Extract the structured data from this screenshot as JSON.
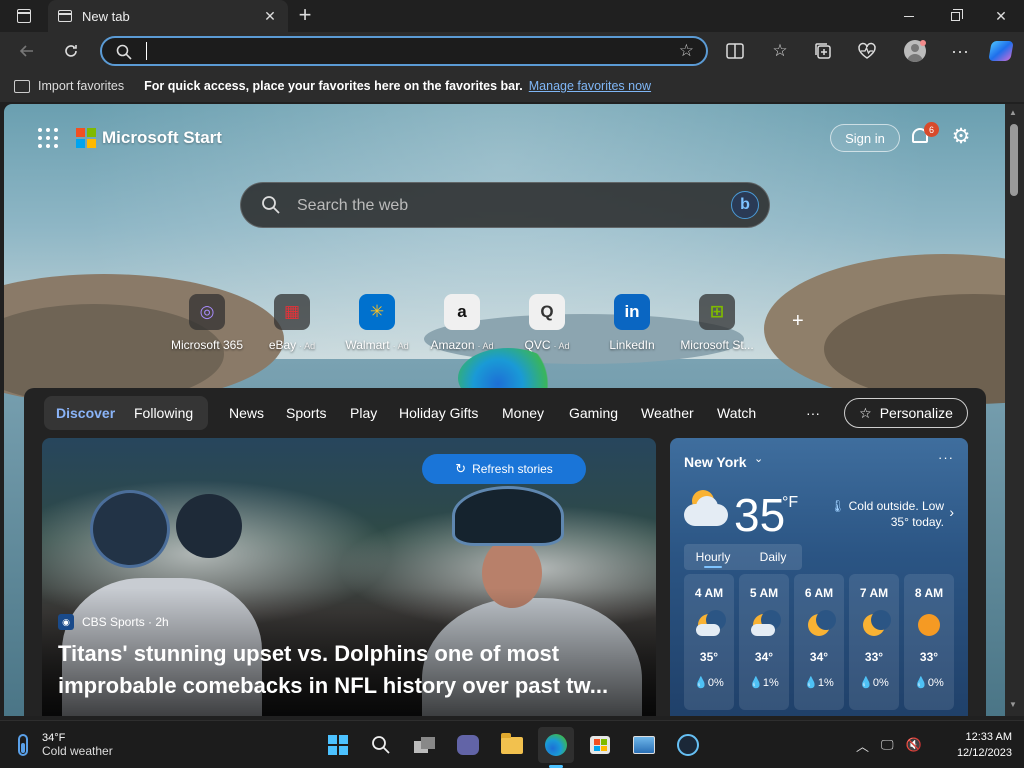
{
  "browser": {
    "tab_title": "New tab",
    "close_glyph": "✕",
    "new_tab_glyph": "+",
    "address_value": "",
    "favorites_bar": {
      "import_label": "Import favorites",
      "message": "For quick access, place your favorites here on the favorites bar.",
      "manage_link": "Manage favorites now"
    }
  },
  "start": {
    "brand": "Microsoft Start",
    "signin_label": "Sign in",
    "notification_count": "6",
    "search_placeholder": "Search the web",
    "quick_links": [
      {
        "label": "Microsoft 365",
        "ad": "",
        "glyph": "◎"
      },
      {
        "label": "eBay",
        "ad": "· Ad",
        "glyph": "▦"
      },
      {
        "label": "Walmart",
        "ad": "· Ad",
        "glyph": "✳"
      },
      {
        "label": "Amazon",
        "ad": "· Ad",
        "glyph": "a"
      },
      {
        "label": "QVC",
        "ad": "· Ad",
        "glyph": "Q"
      },
      {
        "label": "LinkedIn",
        "ad": "",
        "glyph": "in"
      },
      {
        "label": "Microsoft St...",
        "ad": "",
        "glyph": "⊞"
      }
    ],
    "add_link_glyph": "+"
  },
  "feed": {
    "tabs": [
      "Discover",
      "Following"
    ],
    "nav": [
      "News",
      "Sports",
      "Play",
      "Holiday Gifts",
      "Money",
      "Gaming",
      "Weather",
      "Watch"
    ],
    "nav_more": "···",
    "personalize_label": "Personalize",
    "refresh_label": "Refresh stories",
    "hero": {
      "source": "CBS Sports · 2h",
      "title": "Titans' stunning upset vs. Dolphins one of most improbable comebacks in NFL history over past tw..."
    }
  },
  "weather": {
    "city": "New York",
    "temp": "35",
    "unit": "°F",
    "description": "Cold outside. Low 35° today.",
    "tab_hourly": "Hourly",
    "tab_daily": "Daily",
    "hours": [
      {
        "time": "4 AM",
        "icon": "moon-cloud",
        "temp": "35°",
        "precip": "0%"
      },
      {
        "time": "5 AM",
        "icon": "moon-cloud",
        "temp": "34°",
        "precip": "1%"
      },
      {
        "time": "6 AM",
        "icon": "moon",
        "temp": "34°",
        "precip": "1%"
      },
      {
        "time": "7 AM",
        "icon": "moon",
        "temp": "33°",
        "precip": "0%"
      },
      {
        "time": "8 AM",
        "icon": "sun",
        "temp": "33°",
        "precip": "0%"
      }
    ]
  },
  "taskbar": {
    "weather_temp": "34°F",
    "weather_desc": "Cold weather",
    "time": "12:33 AM",
    "date": "12/12/2023"
  }
}
